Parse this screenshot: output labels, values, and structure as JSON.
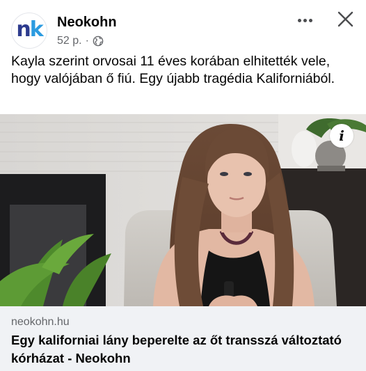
{
  "post": {
    "avatar": {
      "text_n": "n",
      "text_k": "k",
      "color_n": "#2d3b8e",
      "color_k": "#2b9be0"
    },
    "page_name": "Neokohn",
    "time": "52 p.",
    "separator": "·",
    "privacy_icon": "globe-icon",
    "text": "Kayla szerint orvosai 11 éves korában elhitették vele, hogy valójában ő fiú. Egy újabb tragédia Kaliforniából."
  },
  "header_actions": {
    "more_icon": "more-dots-icon",
    "close_icon": "close-icon"
  },
  "photo": {
    "info_icon": "info-icon",
    "info_glyph": "i"
  },
  "link_preview": {
    "domain": "neokohn.hu",
    "title": "Egy kaliforniai lány beperelte az őt transszá változtató kórházat - Neokohn",
    "background": "#f0f2f5"
  }
}
